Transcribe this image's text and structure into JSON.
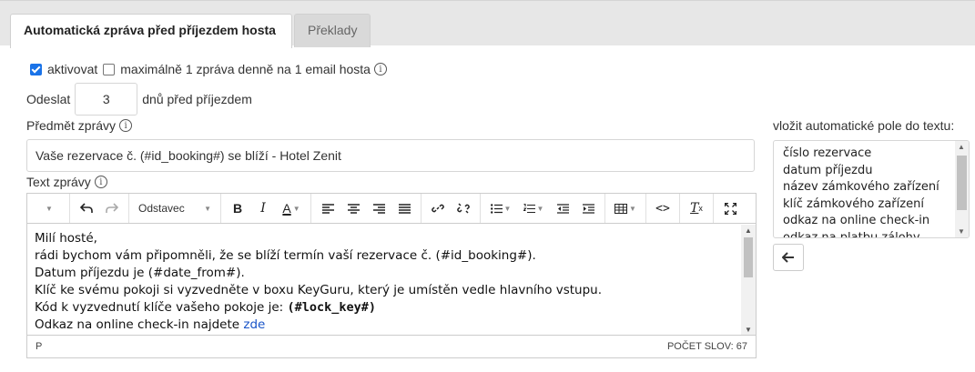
{
  "tabs": [
    {
      "label": "Automatická zpráva před příjezdem hosta",
      "active": true
    },
    {
      "label": "Překlady",
      "active": false
    }
  ],
  "options": {
    "activate_label": "aktivovat",
    "activate_checked": true,
    "limit_label": "maximálně 1 zpráva denně na 1 email hosta",
    "limit_checked": false
  },
  "send": {
    "prefix": "Odeslat",
    "days_value": "3",
    "suffix": "dnů před příjezdem"
  },
  "subject": {
    "label": "Předmět zprávy",
    "value": "Vaše rezervace č. (#id_booking#) se blíží - Hotel Zenit"
  },
  "body": {
    "label": "Text zprávy",
    "block_style": "Odstavec",
    "lines": [
      "Milí hosté,",
      "rádi bychom vám připomněli, že se blíží termín vaší rezervace č. (#id_booking#).",
      "Datum příjezdu je (#date_from#).",
      "Klíč ke svému pokoji si vyzvedněte v boxu KeyGuru, který je umístěn vedle hlavního vstupu.",
      "Kód k vyzvednutí klíče vašeho pokoje je: "
    ],
    "lock_key": "(#lock_key#)",
    "checkin_text": "Odkaz na online check-in najdete ",
    "checkin_link": "zde",
    "path": "P",
    "word_count": "POČET SLOV: 67"
  },
  "fields": {
    "label": "vložit automatické pole do textu:",
    "items": [
      "číslo rezervace",
      "datum příjezdu",
      "název zámkového zařízení",
      "klíč zámkového zařízení",
      "odkaz na online check-in",
      "odkaz na platbu zálohy"
    ]
  },
  "icons": {
    "info": "info-circle-icon",
    "insert": "arrow-left-icon"
  },
  "colors": {
    "checkbox_accent": "#1a73e8",
    "link": "#1a55c8"
  }
}
